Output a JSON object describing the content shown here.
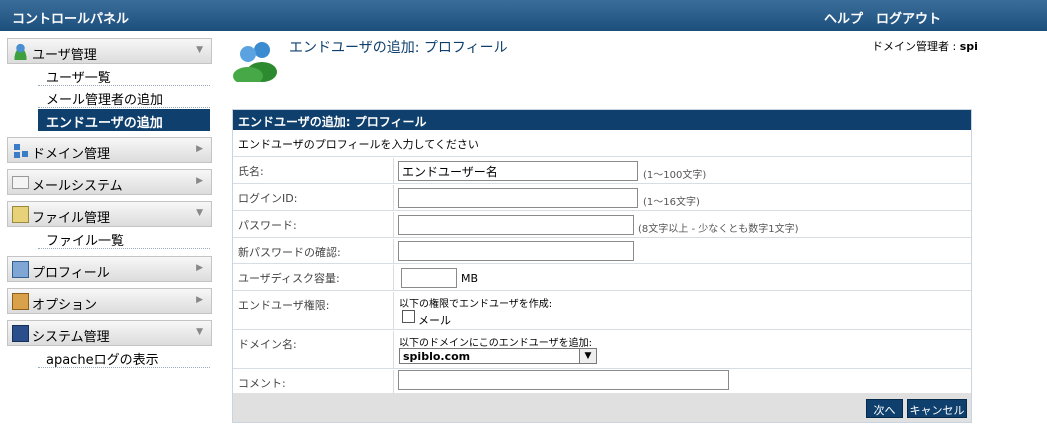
{
  "header": {
    "title": "コントロールパネル",
    "help": "ヘルプ",
    "logout": "ログアウト"
  },
  "sidebar": {
    "sections": [
      {
        "label": "ユーザ管理",
        "icon": "users-icon",
        "expanded": true,
        "items": [
          "ユーザ一覧",
          "メール管理者の追加",
          "エンドユーザの追加"
        ]
      },
      {
        "label": "ドメイン管理",
        "icon": "network-icon",
        "expanded": false
      },
      {
        "label": "メールシステム",
        "icon": "mail-icon",
        "expanded": false
      },
      {
        "label": "ファイル管理",
        "icon": "file-icon",
        "expanded": true,
        "items": [
          "ファイル一覧"
        ]
      },
      {
        "label": "プロフィール",
        "icon": "profile-icon",
        "expanded": false
      },
      {
        "label": "オプション",
        "icon": "option-icon",
        "expanded": false
      },
      {
        "label": "システム管理",
        "icon": "system-icon",
        "expanded": true,
        "items": [
          "apacheログの表示"
        ]
      }
    ],
    "active_item": "エンドユーザの追加"
  },
  "page": {
    "title": "エンドユーザの追加: プロフィール",
    "admin_label": "ドメイン管理者 :",
    "admin_name": "spi"
  },
  "form": {
    "heading": "エンドユーザの追加: プロフィール",
    "description": "エンドユーザのプロフィールを入力してください",
    "name_label": "氏名:",
    "name_value": "エンドユーザー名",
    "name_hint": "(1〜100文字)",
    "login_label": "ログインID:",
    "login_value": "",
    "login_hint": "(1〜16文字)",
    "password_label": "パスワード:",
    "password_hint": "(8文字以上 - 少なくとも数字1文字)",
    "password_confirm_label": "新パスワードの確認:",
    "disk_label": "ユーザディスク容量:",
    "disk_value": "",
    "disk_unit": "MB",
    "perm_label": "エンドユーザ権限:",
    "perm_text": "以下の権限でエンドユーザを作成:",
    "perm_mail": "メール",
    "domain_label": "ドメイン名:",
    "domain_text": "以下のドメインにこのエンドユーザを追加:",
    "domain_value": "spiblo.com",
    "comment_label": "コメント:",
    "comment_value": "",
    "next_button": "次へ",
    "cancel_button": "キャンセル"
  },
  "colors": {
    "topbar": "#1d4f7d",
    "accent": "#0e3f6d"
  }
}
